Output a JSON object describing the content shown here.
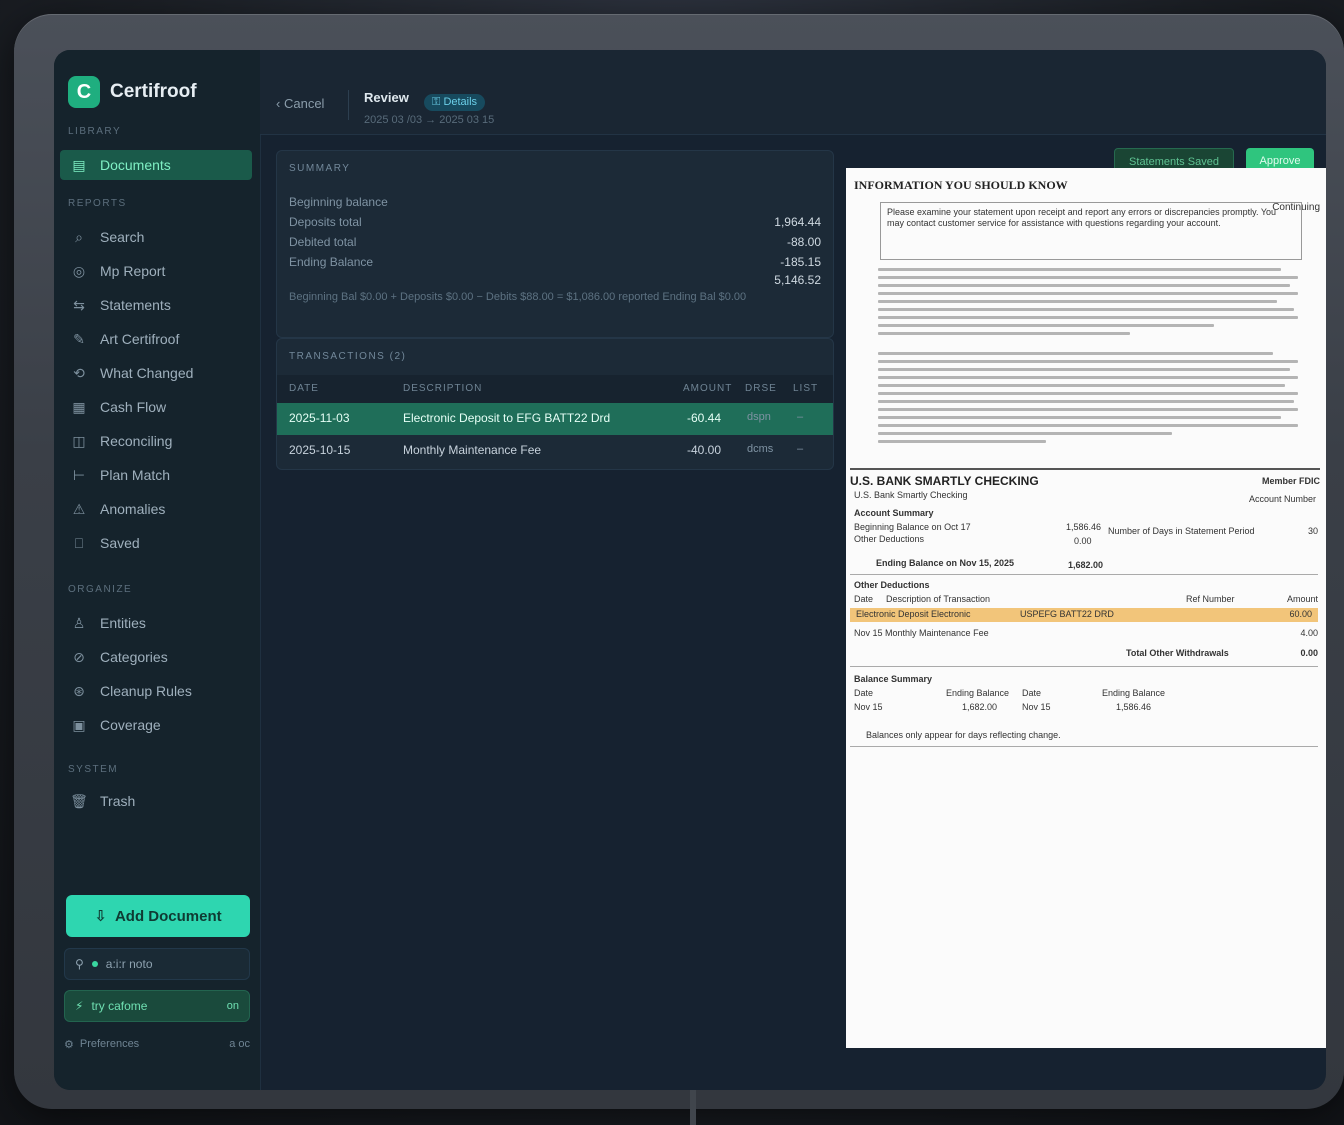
{
  "app": {
    "name": "Certifroof"
  },
  "sidebar": {
    "sections": [
      {
        "label": "LIBRARY"
      },
      {
        "label": "REPORTS"
      },
      {
        "label": "ORGANIZE"
      },
      {
        "label": "SYSTEM"
      }
    ],
    "items": [
      {
        "label": "Documents",
        "icon": "document-icon"
      },
      {
        "label": "Search",
        "icon": "search-icon"
      },
      {
        "label": "Mp Report",
        "icon": "report-icon"
      },
      {
        "label": "Statements",
        "icon": "statements-icon"
      },
      {
        "label": "Art Certifroof",
        "icon": "certify-icon"
      },
      {
        "label": "What Changed",
        "icon": "diff-icon"
      },
      {
        "label": "Cash Flow",
        "icon": "cashflow-icon"
      },
      {
        "label": "Reconciling",
        "icon": "reconcile-icon"
      },
      {
        "label": "Plan Match",
        "icon": "plan-icon"
      },
      {
        "label": "Anomalies",
        "icon": "warning-icon"
      },
      {
        "label": "Saved",
        "icon": "bookmark-icon"
      },
      {
        "label": "Entities",
        "icon": "entities-icon"
      },
      {
        "label": "Categories",
        "icon": "tag-icon"
      },
      {
        "label": "Cleanup Rules",
        "icon": "rules-icon"
      },
      {
        "label": "Coverage",
        "icon": "coverage-icon"
      },
      {
        "label": "Trash",
        "icon": "trash-icon"
      }
    ],
    "add_button": "Add Document",
    "status_1": "a:i:r noto",
    "status_2": "try cafome",
    "status_2_end": "on",
    "footer_label": "Preferences",
    "footer_end": "a oc"
  },
  "topbar": {
    "back": "Cancel",
    "title": "Review",
    "badge": "Details",
    "subtitle": "2025 03 /03 → 2025 03 15",
    "secondary_button": "Statements Saved",
    "primary_button": "Approve"
  },
  "summary": {
    "title": "SUMMARY",
    "rows": [
      {
        "label": "Beginning balance",
        "value": ""
      },
      {
        "label": "Deposits total",
        "value": "1,964.44"
      },
      {
        "label": "Debited total",
        "value": "-88.00"
      },
      {
        "label": "Ending Balance",
        "value": "-185.15"
      },
      {
        "label": "",
        "value": "5,146.52"
      }
    ],
    "footer": "Beginning Bal $0.00 + Deposits $0.00 − Debits $88.00 = $1,086.00 reported Ending Bal $0.00"
  },
  "transactions": {
    "title": "TRANSACTIONS (2)",
    "columns": [
      "DATE",
      "DESCRIPTION",
      "AMOUNT",
      "DRSE",
      "LIST"
    ],
    "rows": [
      {
        "date": "2025-11-03",
        "description": "Electronic Deposit to EFG BATT22 Drd",
        "amount": "-60.44",
        "type": "dspn",
        "list": "–"
      },
      {
        "date": "2025-10-15",
        "description": "Monthly Maintenance Fee",
        "amount": "-40.00",
        "type": "dcms",
        "list": "–"
      }
    ]
  },
  "document": {
    "header": "INFORMATION YOU SHOULD KNOW",
    "tag": "Continuing",
    "box_text": "Please examine your statement upon receipt and report any errors or discrepancies promptly. You may contact customer service for assistance with questions regarding your account.",
    "section_title": "U.S. BANK SMARTLY CHECKING",
    "section_sub": "U.S. Bank Smartly Checking",
    "section_tag": "Member FDIC",
    "account_no_label": "Account Number",
    "account_summary_label": "Account Summary",
    "beginning_balance": "Beginning Balance on Oct 17",
    "beginning_value": "1,586.46",
    "deposits_label": "Other Deductions",
    "deposits_value": "0.00",
    "ending_balance": "Ending Balance on Nov 15, 2025",
    "ending_value": "1,682.00",
    "days_label": "Number of Days in Statement Period",
    "days_value": "30",
    "other_deductions": "Other Deductions",
    "col_date": "Date",
    "col_desc": "Description of Transaction",
    "col_ref": "Ref Number",
    "col_amount": "Amount",
    "highlight_desc": "Electronic Deposit Electronic",
    "highlight_ref": "USPEFG BATT22 DRD",
    "highlight_amount": "60.00",
    "row2_desc": "Nov 15 Monthly Maintenance Fee",
    "row2_amount": "4.00",
    "total_label": "Total Other Withdrawals",
    "total_value": "0.00",
    "balance_summary": "Balance Summary",
    "bs_date": "Date",
    "bs_ending": "Ending Balance",
    "bs_date2": "Date",
    "bs_ending2": "Ending Balance",
    "bs_r1d": "Nov 15",
    "bs_r1v": "1,682.00",
    "bs_r2d": "Nov 15",
    "bs_r2v": "1,586.46",
    "footnote": "Balances only appear for days reflecting change."
  }
}
